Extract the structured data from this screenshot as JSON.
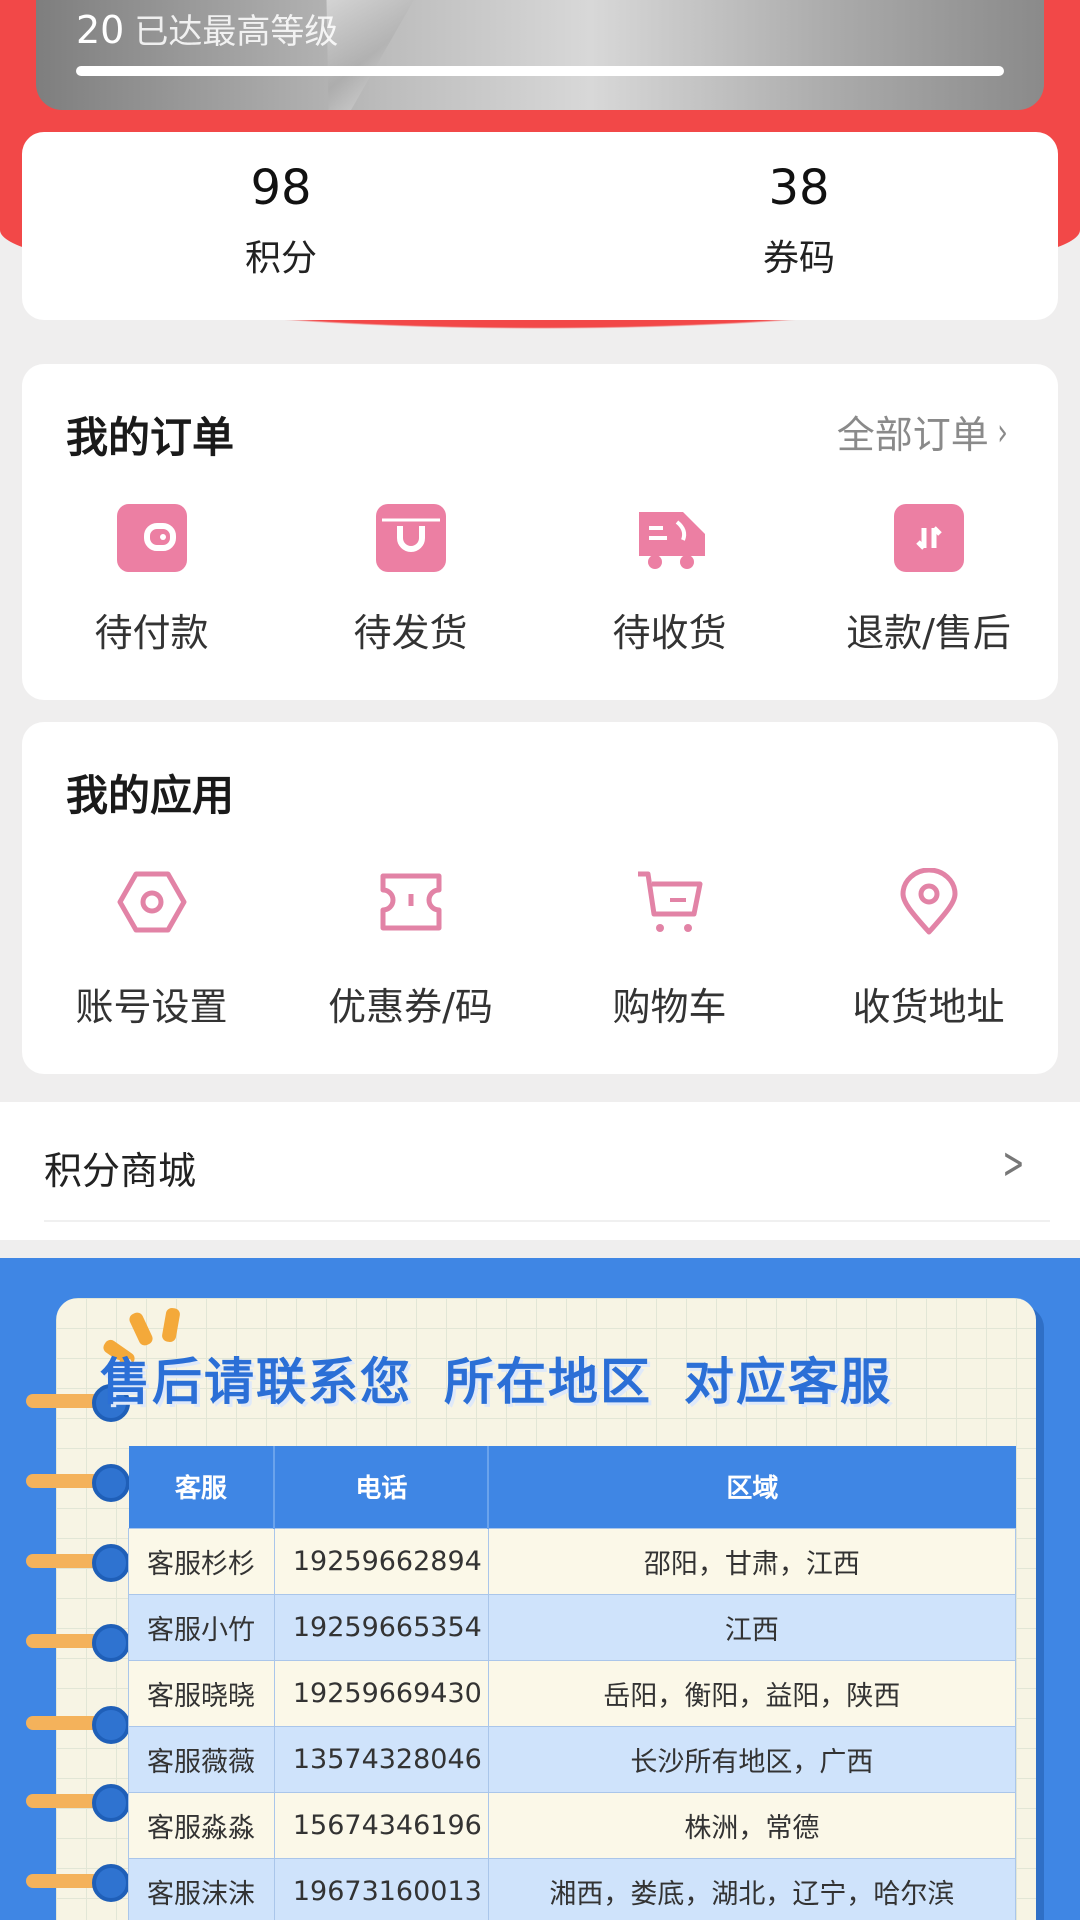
{
  "level": {
    "number": "20",
    "status": "已达最高等级"
  },
  "stats": [
    {
      "value": "98",
      "label": "积分"
    },
    {
      "value": "38",
      "label": "券码"
    }
  ],
  "orders": {
    "title": "我的订单",
    "all_link": "全部订单",
    "items": [
      {
        "label": "待付款",
        "icon": "wallet-icon"
      },
      {
        "label": "待发货",
        "icon": "package-icon"
      },
      {
        "label": "待收货",
        "icon": "delivery-truck-icon"
      },
      {
        "label": "退款/售后",
        "icon": "refund-icon"
      }
    ]
  },
  "apps": {
    "title": "我的应用",
    "items": [
      {
        "label": "账号设置",
        "icon": "settings-hexagon-icon"
      },
      {
        "label": "优惠券/码",
        "icon": "coupon-icon"
      },
      {
        "label": "购物车",
        "icon": "shopping-cart-icon"
      },
      {
        "label": "收货地址",
        "icon": "location-pin-icon"
      }
    ]
  },
  "points_mall": {
    "label": "积分商城"
  },
  "banner": {
    "title_parts": [
      "售后请联系您",
      "所在地区",
      "对应客服"
    ],
    "table": {
      "headers": [
        "客服",
        "电话",
        "区域"
      ],
      "rows": [
        [
          "客服杉杉",
          "19259662894",
          "邵阳，甘肃，江西"
        ],
        [
          "客服小竹",
          "19259665354",
          "江西"
        ],
        [
          "客服晓晓",
          "19259669430",
          "岳阳，衡阳，益阳，陕西"
        ],
        [
          "客服薇薇",
          "13574328046",
          "长沙所有地区，广西"
        ],
        [
          "客服淼淼",
          "15674346196",
          "株洲，常德"
        ],
        [
          "客服沫沫",
          "19673160013",
          "湘西，娄底，湖北，辽宁，哈尔滨"
        ]
      ]
    }
  },
  "colors": {
    "header_red": "#f24848",
    "icon_pink": "#ec7fa3",
    "banner_blue": "#3f86e4"
  }
}
